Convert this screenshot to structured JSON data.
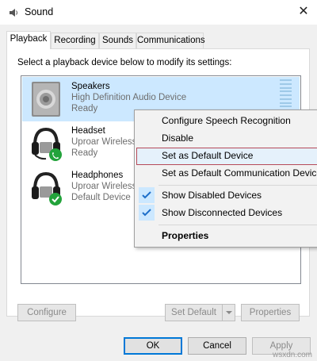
{
  "window": {
    "title": "Sound",
    "close_glyph": "✕"
  },
  "tabs": [
    "Playback",
    "Recording",
    "Sounds",
    "Communications"
  ],
  "instruction": "Select a playback device below to modify its settings:",
  "devices": [
    {
      "name": "Speakers",
      "description": "High Definition Audio Device",
      "status": "Ready",
      "icon": "speaker-icon"
    },
    {
      "name": "Headset",
      "description": "Uproar Wireless",
      "status": "Ready",
      "icon": "headset-icon"
    },
    {
      "name": "Headphones",
      "description": "Uproar Wireless",
      "status": "Default Device",
      "icon": "headphones-icon"
    }
  ],
  "panel_buttons": {
    "configure": "Configure",
    "set_default": "Set Default",
    "properties": "Properties"
  },
  "dialog_buttons": {
    "ok": "OK",
    "cancel": "Cancel",
    "apply": "Apply"
  },
  "context_menu": {
    "configure_speech": "Configure Speech Recognition",
    "disable": "Disable",
    "set_default": "Set as Default Device",
    "set_default_comm": "Set as Default Communication Device",
    "show_disabled": "Show Disabled Devices",
    "show_disconnected": "Show Disconnected Devices",
    "properties": "Properties"
  },
  "watermark": "wsxdn.com",
  "colors": {
    "selection": "#cce8ff",
    "accent": "#0078d7",
    "hover_border": "#b64a5a",
    "check": "#1e6fc9",
    "badge_green": "#23a33b"
  }
}
